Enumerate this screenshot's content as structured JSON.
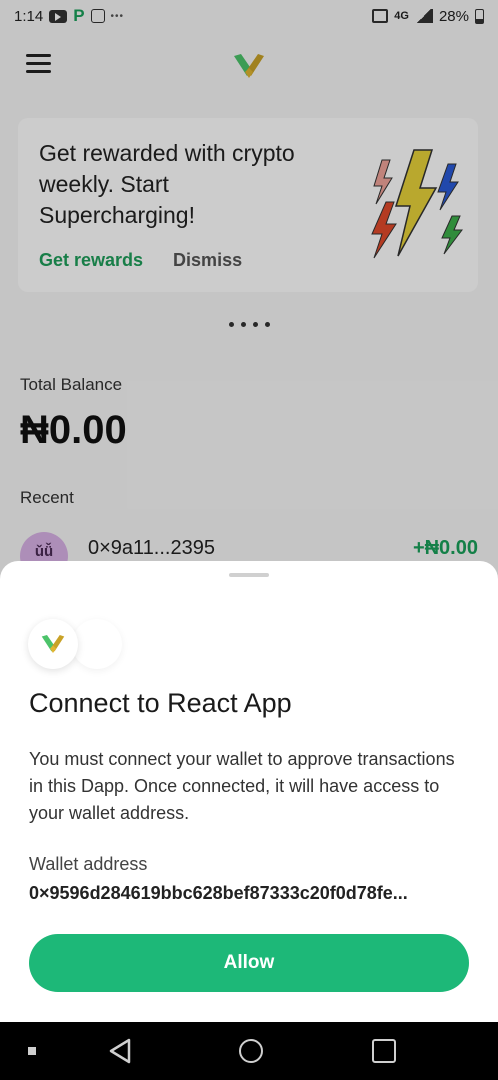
{
  "status_bar": {
    "time": "1:14",
    "network": "4G",
    "battery": "28%"
  },
  "promo": {
    "text": "Get rewarded with crypto weekly. Start Supercharging!",
    "primary_action": "Get rewards",
    "secondary_action": "Dismiss"
  },
  "balance": {
    "label": "Total Balance",
    "value": "₦0.00"
  },
  "recent": {
    "label": "Recent",
    "items": [
      {
        "avatar": "ǔǚ",
        "address": "0×9a11...2395",
        "amount": "+₦0.00"
      }
    ]
  },
  "sheet": {
    "title": "Connect to React App",
    "description": "You must connect your wallet to approve transactions in this Dapp. Once connected, it will have access to your wallet address.",
    "wallet_label": "Wallet address",
    "wallet_address": "0×9596d284619bbc628bef87333c20f0d78fe...",
    "allow_label": "Allow"
  },
  "colors": {
    "accent_green": "#1db878",
    "promo_link": "#1e9e5a",
    "logo_green": "#4cc36a",
    "logo_gold": "#c9a227"
  },
  "icons": {
    "menu": "hamburger-icon",
    "logo": "v-logo-icon",
    "back": "back-triangle-icon",
    "home": "home-circle-icon",
    "recents": "recents-square-icon"
  }
}
